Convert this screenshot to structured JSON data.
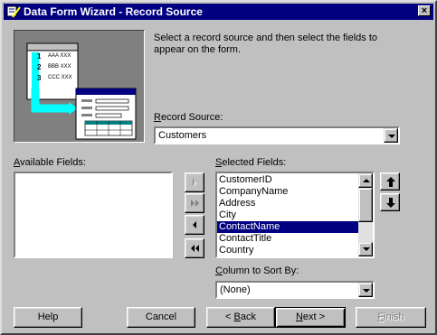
{
  "window": {
    "title": "Data Form Wizard - Record Source",
    "close_glyph": "×"
  },
  "illustration": {
    "row_numbers": [
      "1",
      "2",
      "3"
    ],
    "row_texts": [
      "AAA XXX",
      "BBB XXX",
      "CCC XXX"
    ]
  },
  "instruction": {
    "line1": "Select a record source and then select the fields to",
    "line2": "appear on the form."
  },
  "record_source": {
    "label_first": "R",
    "label_rest": "ecord Source:",
    "value": "Customers"
  },
  "available_fields": {
    "label_first": "A",
    "label_rest": "vailable Fields:",
    "items": []
  },
  "selected_fields": {
    "label_first": "S",
    "label_rest": "elected Fields:",
    "items": [
      "CustomerID",
      "CompanyName",
      "Address",
      "City",
      "ContactName",
      "ContactTitle",
      "Country"
    ],
    "selected_index": 4
  },
  "move_buttons": [
    {
      "name": "add-one-field-button",
      "icon": "chevron-right-icon",
      "enabled": false
    },
    {
      "name": "add-all-fields-button",
      "icon": "double-chevron-right-icon",
      "enabled": false
    },
    {
      "name": "remove-one-field-button",
      "icon": "chevron-left-icon",
      "enabled": true
    },
    {
      "name": "remove-all-fields-button",
      "icon": "double-chevron-left-icon",
      "enabled": true
    }
  ],
  "order_buttons": [
    {
      "name": "move-field-up-button",
      "icon": "arrow-up-icon"
    },
    {
      "name": "move-field-down-button",
      "icon": "arrow-down-icon"
    }
  ],
  "sort": {
    "label_first": "C",
    "label_rest": "olumn to Sort By:",
    "value": "(None)"
  },
  "buttons": {
    "help": "Help",
    "cancel": "Cancel",
    "back_prefix": "< ",
    "back_first": "B",
    "back_rest": "ack",
    "next_first": "N",
    "next_rest": "ext >",
    "finish_first": "F",
    "finish_rest": "inish"
  },
  "colors": {
    "titlebar": "#000080",
    "selection": "#000080",
    "face": "#c0c0c0",
    "illustration_accent": "#00ffff"
  }
}
